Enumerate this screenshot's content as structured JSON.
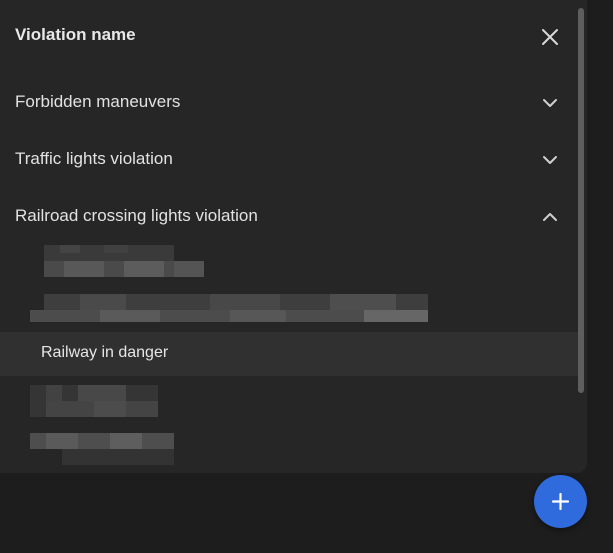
{
  "header": {
    "title": "Violation name",
    "close_icon": "close-icon"
  },
  "groups": [
    {
      "label": "Forbidden maneuvers",
      "expanded": false,
      "icon": "chevron-down-icon"
    },
    {
      "label": "Traffic lights violation",
      "expanded": false,
      "icon": "chevron-down-icon"
    },
    {
      "label": "Railroad crossing lights violation",
      "expanded": true,
      "icon": "chevron-up-icon"
    }
  ],
  "subitems": {
    "visible_label": "Railway in danger"
  },
  "fab": {
    "icon": "plus-icon",
    "color": "#2f6bdc"
  },
  "colors": {
    "panel": "#262626",
    "background": "#1d1d1d",
    "selected_row": "#303030",
    "text": "#e2e2e2"
  }
}
